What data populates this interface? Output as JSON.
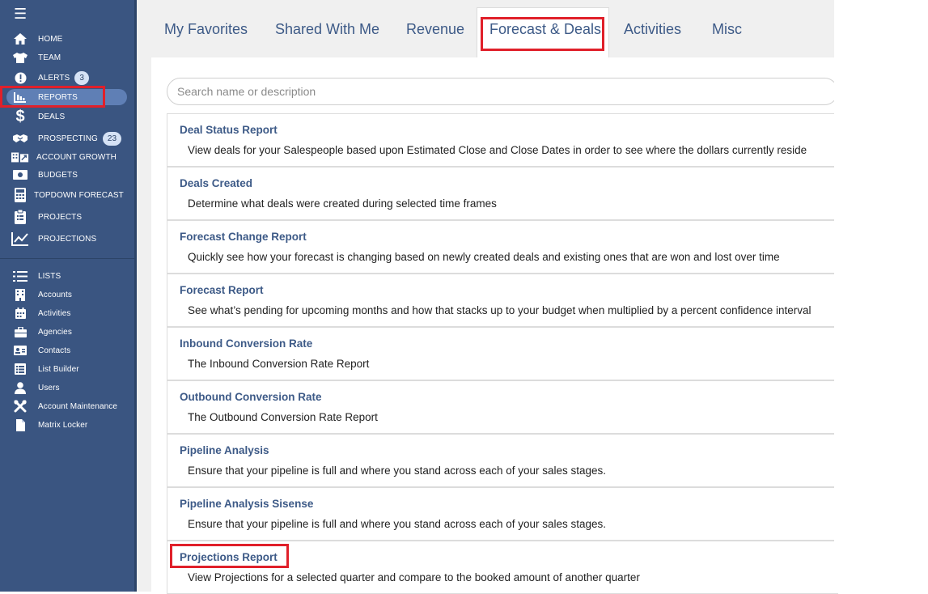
{
  "sidebar": {
    "main_items": [
      {
        "label": "HOME",
        "icon": "home-icon"
      },
      {
        "label": "TEAM",
        "icon": "shirt-icon"
      },
      {
        "label": "ALERTS",
        "icon": "alert-icon",
        "badge": "3"
      },
      {
        "label": "REPORTS",
        "icon": "report-icon"
      },
      {
        "label": "DEALS",
        "icon": "dollar-icon"
      },
      {
        "label": "PROSPECTING",
        "icon": "handshake-icon",
        "badge": "23"
      },
      {
        "label": "ACCOUNT GROWTH",
        "icon": "building-growth-icon"
      },
      {
        "label": "BUDGETS",
        "icon": "money-icon"
      },
      {
        "label": "TOPDOWN FORECAST",
        "icon": "calculator-icon"
      },
      {
        "label": "PROJECTS",
        "icon": "clipboard-icon"
      },
      {
        "label": "PROJECTIONS",
        "icon": "line-chart-icon"
      }
    ],
    "lists_header": "LISTS",
    "list_items": [
      {
        "label": "Accounts",
        "icon": "building-icon"
      },
      {
        "label": "Activities",
        "icon": "calendar-icon"
      },
      {
        "label": "Agencies",
        "icon": "briefcase-icon"
      },
      {
        "label": "Contacts",
        "icon": "contact-card-icon"
      },
      {
        "label": "List Builder",
        "icon": "list-builder-icon"
      },
      {
        "label": "Users",
        "icon": "user-icon"
      },
      {
        "label": "Account Maintenance",
        "icon": "wrench-icon"
      },
      {
        "label": "Matrix Locker",
        "icon": "file-icon"
      }
    ],
    "colors": {
      "background": "#3a5581",
      "active_pill": "#5f7fb5",
      "highlight": "#e0202a"
    }
  },
  "tabs": [
    "My Favorites",
    "Shared With Me",
    "Revenue",
    "Forecast & Deals",
    "Activities",
    "Misc"
  ],
  "active_tab": "Forecast & Deals",
  "search": {
    "placeholder": "Search name or description",
    "value": ""
  },
  "reports": [
    {
      "title": "Deal Status Report",
      "description": "View deals for your Salespeople based upon Estimated Close and Close Dates in order to see where the dollars currently reside"
    },
    {
      "title": "Deals Created",
      "description": "Determine what deals were created during selected time frames"
    },
    {
      "title": "Forecast Change Report",
      "description": "Quickly see how your forecast is changing based on newly created deals and existing ones that are won and lost over time"
    },
    {
      "title": "Forecast Report",
      "description": "See what’s pending for upcoming months and how that stacks up to your budget when multiplied by a percent confidence interval"
    },
    {
      "title": "Inbound Conversion Rate",
      "description": "The Inbound Conversion Rate Report"
    },
    {
      "title": "Outbound Conversion Rate",
      "description": "The Outbound Conversion Rate Report"
    },
    {
      "title": "Pipeline Analysis",
      "description": "Ensure that your pipeline is full and where you stand across each of your sales stages."
    },
    {
      "title": "Pipeline Analysis Sisense",
      "description": "Ensure that your pipeline is full and where you stand across each of your sales stages."
    },
    {
      "title": "Projections Report",
      "description": "View Projections for a selected quarter and compare to the booked amount of another quarter"
    }
  ]
}
